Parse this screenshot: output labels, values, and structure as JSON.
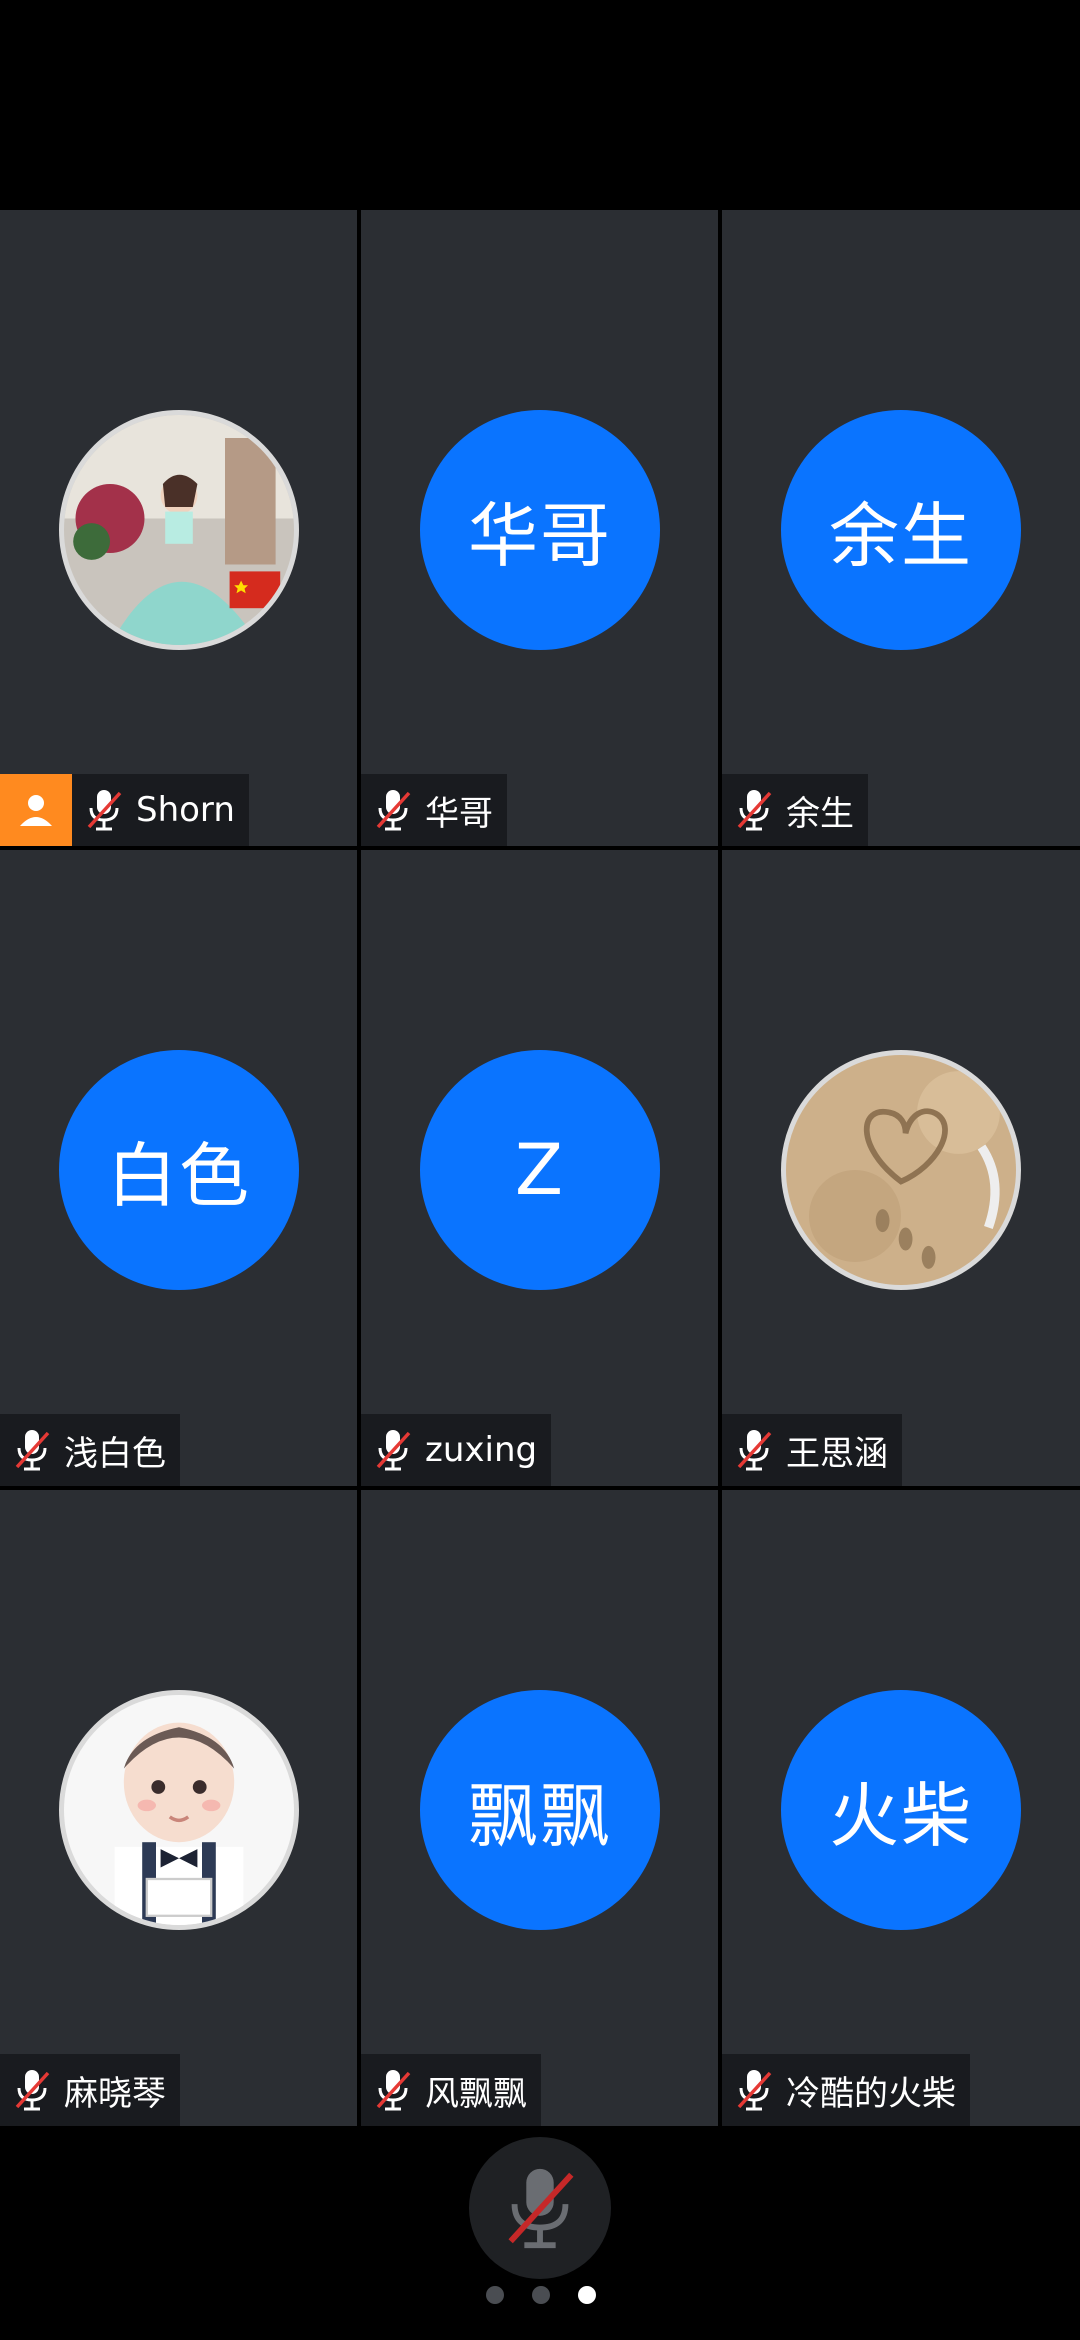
{
  "participants": [
    {
      "avatar_type": "photo",
      "avatar_icon": "woman-in-gown-photo",
      "avatar_text": "",
      "name": "Shorn",
      "is_host": true,
      "mic": "muted"
    },
    {
      "avatar_type": "text",
      "avatar_text": "华哥",
      "name": "华哥",
      "is_host": false,
      "mic": "muted"
    },
    {
      "avatar_type": "text",
      "avatar_text": "余生",
      "name": "余生",
      "is_host": false,
      "mic": "muted"
    },
    {
      "avatar_type": "text",
      "avatar_text": "白色",
      "name": "浅白色",
      "is_host": false,
      "mic": "muted"
    },
    {
      "avatar_type": "text",
      "avatar_text": "Z",
      "name": "zuxing",
      "is_host": false,
      "mic": "muted"
    },
    {
      "avatar_type": "photo",
      "avatar_icon": "heart-in-sand-photo",
      "avatar_text": "",
      "name": "王思涵",
      "is_host": false,
      "mic": "muted"
    },
    {
      "avatar_type": "photo",
      "avatar_icon": "cartoon-boy-photo",
      "avatar_text": "",
      "name": "麻晓琴",
      "is_host": false,
      "mic": "muted"
    },
    {
      "avatar_type": "text",
      "avatar_text": "飘飘",
      "name": "风飘飘",
      "is_host": false,
      "mic": "muted"
    },
    {
      "avatar_type": "text",
      "avatar_text": "火柴",
      "name": "冷酷的火柴",
      "is_host": false,
      "mic": "muted"
    }
  ],
  "controls": {
    "mic_state": "muted",
    "mic_icon": "microphone-muted-icon"
  },
  "pagination": {
    "total_pages": 3,
    "current_page": 3
  },
  "colors": {
    "avatar_blue": "#0a74ff",
    "tile_bg": "#2b2e33",
    "host_badge": "#ff8a1f",
    "muted_slash": "#e53935"
  }
}
